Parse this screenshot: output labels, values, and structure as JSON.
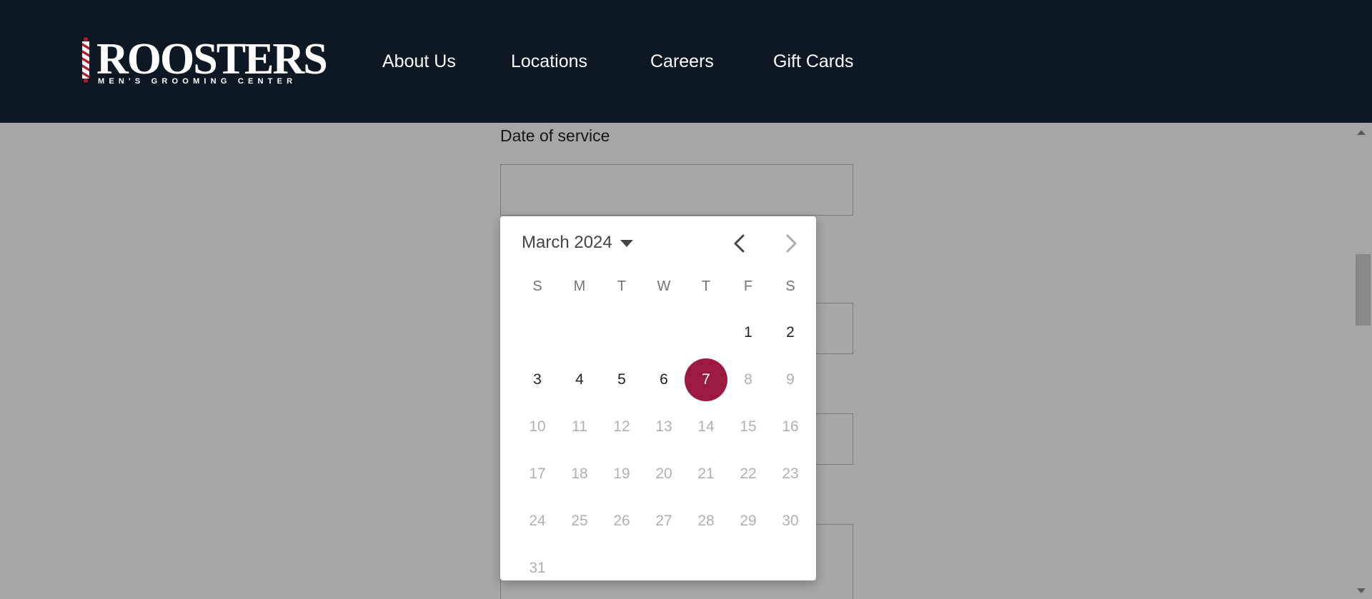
{
  "brand": {
    "name": "ROOSTERS",
    "tagline": "MEN'S GROOMING CENTER"
  },
  "nav": [
    {
      "label": "About Us"
    },
    {
      "label": "Locations"
    },
    {
      "label": "Careers"
    },
    {
      "label": "Gift Cards"
    }
  ],
  "form": {
    "date_label": "Date of service",
    "date_value": ""
  },
  "calendar": {
    "month_label": "March 2024",
    "prev_icon": "chevron-left-icon",
    "next_icon": "chevron-right-icon",
    "weekdays": [
      "S",
      "M",
      "T",
      "W",
      "T",
      "F",
      "S"
    ],
    "days": [
      {
        "label": "1",
        "enabled": true
      },
      {
        "label": "2",
        "enabled": true
      },
      {
        "label": "3",
        "enabled": true
      },
      {
        "label": "4",
        "enabled": true
      },
      {
        "label": "5",
        "enabled": true
      },
      {
        "label": "6",
        "enabled": true
      },
      {
        "label": "7",
        "enabled": true,
        "selected": true
      },
      {
        "label": "8",
        "enabled": false
      },
      {
        "label": "9",
        "enabled": false
      },
      {
        "label": "10",
        "enabled": false
      },
      {
        "label": "11",
        "enabled": false
      },
      {
        "label": "12",
        "enabled": false
      },
      {
        "label": "13",
        "enabled": false
      },
      {
        "label": "14",
        "enabled": false
      },
      {
        "label": "15",
        "enabled": false
      },
      {
        "label": "16",
        "enabled": false
      },
      {
        "label": "17",
        "enabled": false
      },
      {
        "label": "18",
        "enabled": false
      },
      {
        "label": "19",
        "enabled": false
      },
      {
        "label": "20",
        "enabled": false
      },
      {
        "label": "21",
        "enabled": false
      },
      {
        "label": "22",
        "enabled": false
      },
      {
        "label": "23",
        "enabled": false
      },
      {
        "label": "24",
        "enabled": false
      },
      {
        "label": "25",
        "enabled": false
      },
      {
        "label": "26",
        "enabled": false
      },
      {
        "label": "27",
        "enabled": false
      },
      {
        "label": "28",
        "enabled": false
      },
      {
        "label": "29",
        "enabled": false
      },
      {
        "label": "30",
        "enabled": false
      },
      {
        "label": "31",
        "enabled": false
      }
    ]
  },
  "colors": {
    "header_bg": "#0e1824",
    "selected_day": "#9c1a3f",
    "barber_pole_red": "#b01e2e"
  }
}
